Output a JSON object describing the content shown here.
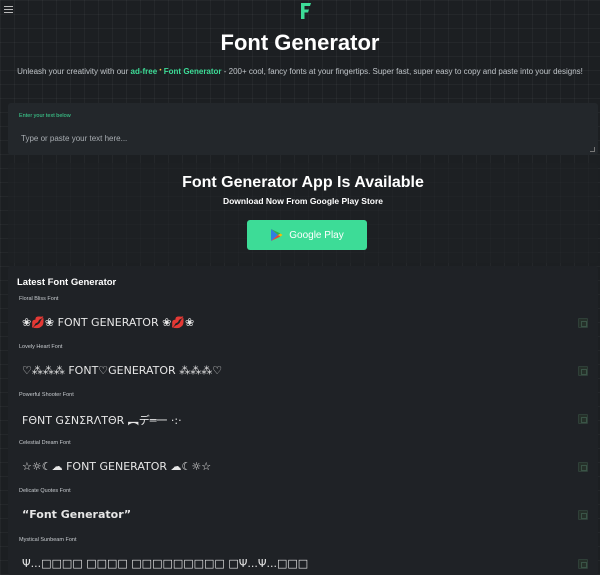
{
  "header": {
    "title": "Font Generator",
    "subtitle_pre": "Unleash your creativity with our ",
    "subtitle_hl1": "ad-free",
    "subtitle_dot": "•",
    "subtitle_hl2": "Font Generator",
    "subtitle_post": " - 200+ cool, fancy fonts at your fingertips. Super fast, super easy to copy and paste into your designs!",
    "logo": "F",
    "brand_color": "#3ddc97"
  },
  "input": {
    "label": "Enter your text below",
    "placeholder": "Type or paste your text here..."
  },
  "app_promo": {
    "title": "Font Generator App Is Available",
    "subtitle": "Download Now From Google Play Store",
    "button_label": "Google Play"
  },
  "font_list": {
    "title": "Latest Font Generator",
    "items": [
      {
        "name": "Floral Bliss Font",
        "sample": "❀💋❀ FONT GENERATOR ❀💋❀"
      },
      {
        "name": "Lovely Heart Font",
        "sample": "♡⁂⁂⁂ FONT♡GENERATOR ⁂⁂⁂♡"
      },
      {
        "name": "Powerful Shooter Font",
        "sample": "FΘNT GΣNΣRΛTΘR ︻デ═一 ·:·"
      },
      {
        "name": "Celestial Dream Font",
        "sample": "☆☼☾☁ FONT GENERATOR ☁☾☼☆"
      },
      {
        "name": "Delicate Quotes Font",
        "sample": "“Font Generator”"
      },
      {
        "name": "Mystical Sunbeam Font",
        "sample": "Ψ...□□□□ □□□□ □□□□□□□□□ □Ψ...Ψ...□□□"
      }
    ]
  }
}
